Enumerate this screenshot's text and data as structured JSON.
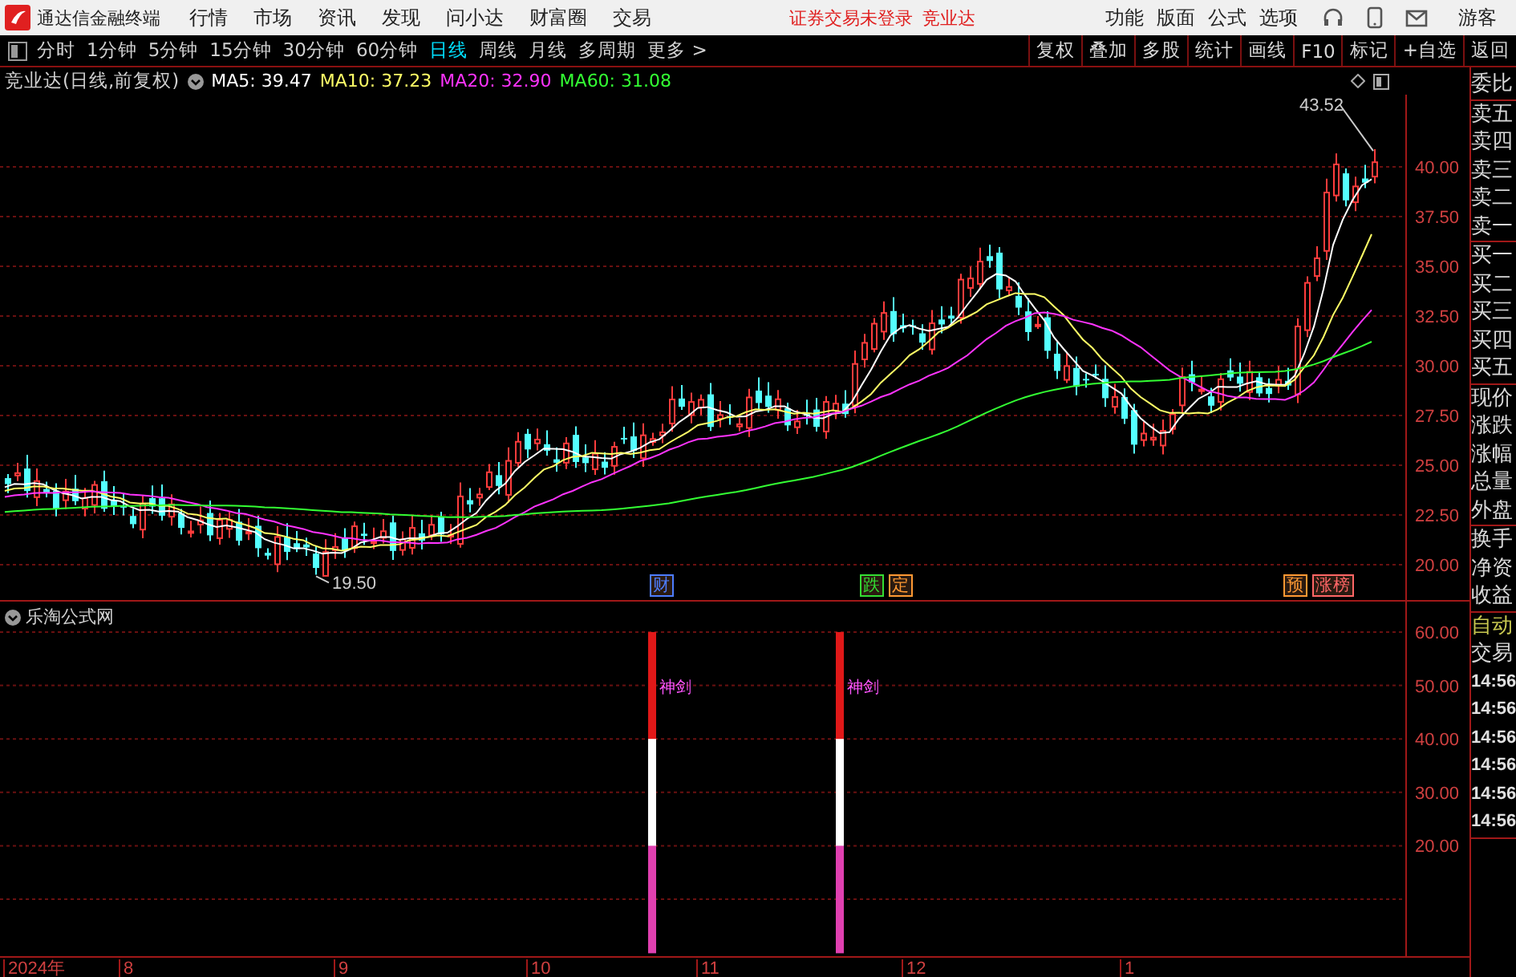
{
  "app": {
    "title": "通达信金融终端",
    "menu": [
      "行情",
      "市场",
      "资讯",
      "发现",
      "问小达",
      "财富圈",
      "交易"
    ],
    "notice": "证券交易未登录",
    "stock_link": "竞业达",
    "tools": [
      "功能",
      "版面",
      "公式",
      "选项"
    ],
    "user": "游客"
  },
  "periods": [
    {
      "label": "分时",
      "selected": false
    },
    {
      "label": "1分钟",
      "selected": false
    },
    {
      "label": "5分钟",
      "selected": false
    },
    {
      "label": "15分钟",
      "selected": false
    },
    {
      "label": "30分钟",
      "selected": false
    },
    {
      "label": "60分钟",
      "selected": false
    },
    {
      "label": "日线",
      "selected": true
    },
    {
      "label": "周线",
      "selected": false
    },
    {
      "label": "月线",
      "selected": false
    },
    {
      "label": "多周期",
      "selected": false
    },
    {
      "label": "更多 >",
      "selected": false
    }
  ],
  "actions": [
    "复权",
    "叠加",
    "多股",
    "统计",
    "画线",
    "F10",
    "标记",
    "+自选",
    "返回"
  ],
  "chart": {
    "title": "竞业达(日线,前复权)",
    "ma": [
      {
        "label": "MA5: 39.47",
        "color": "#ffffff"
      },
      {
        "label": "MA10: 37.23",
        "color": "#ffff66"
      },
      {
        "label": "MA20: 32.90",
        "color": "#ff33ff"
      },
      {
        "label": "MA60: 31.08",
        "color": "#33ff33"
      }
    ],
    "high_label": "43.52",
    "low_label": "19.50",
    "price_ticks": [
      "40.00",
      "37.50",
      "35.00",
      "32.50",
      "30.00",
      "27.50",
      "25.00",
      "22.50",
      "20.00"
    ],
    "events": [
      {
        "label": "财",
        "color": "#4d7dff"
      },
      {
        "label": "跌",
        "color": "#33dd33"
      },
      {
        "label": "定",
        "color": "#ff9933"
      },
      {
        "label": "预",
        "color": "#ff9933"
      },
      {
        "label": "涨榜",
        "color": "#ff6666"
      }
    ]
  },
  "quote_panel": {
    "groups": [
      [
        "委比"
      ],
      [
        "卖五",
        "卖四",
        "卖三",
        "卖二",
        "卖一"
      ],
      [
        "买一",
        "买二",
        "买三",
        "买四",
        "买五"
      ],
      [
        "现价",
        "涨跌",
        "涨幅",
        "总量",
        "外盘"
      ],
      [
        "换手",
        "净资",
        "收益"
      ]
    ],
    "lower": [
      {
        "label": "自动",
        "kind": "status"
      },
      {
        "label": "交易",
        "kind": "label"
      },
      {
        "label": "14:56",
        "kind": "time"
      },
      {
        "label": "14:56",
        "kind": "time"
      },
      {
        "label": "14:56",
        "kind": "time"
      },
      {
        "label": "14:56",
        "kind": "time"
      },
      {
        "label": "14:56",
        "kind": "time"
      },
      {
        "label": "14:56",
        "kind": "time"
      }
    ]
  },
  "indicator": {
    "title": "乐淘公式网",
    "ticks": [
      "60.00",
      "50.00",
      "40.00",
      "30.00",
      "20.00"
    ],
    "signals": [
      {
        "label": "神剑"
      },
      {
        "label": "神剑"
      }
    ]
  },
  "x_axis": [
    "2024年",
    "8",
    "9",
    "10",
    "11",
    "12",
    "1"
  ]
}
